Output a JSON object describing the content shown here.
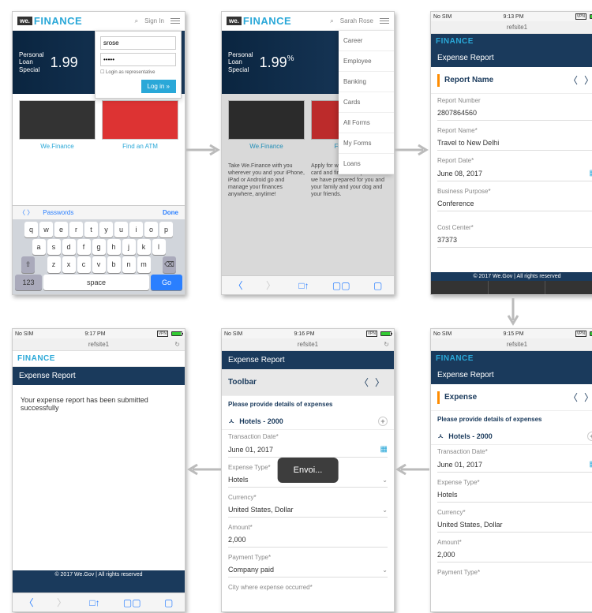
{
  "status": {
    "carrier": "No SIM",
    "vpn": "VPN",
    "t1": "9:13 PM",
    "t2": "9:15 PM",
    "t3": "9:16 PM",
    "t4": "9:17 PM",
    "addr": "refsite1"
  },
  "brand": {
    "we": "we.",
    "fin": "FINANCE",
    "signin": "Sign In",
    "user": "Sarah Rose"
  },
  "login": {
    "u": "srose",
    "p": "•••••",
    "chk": "Login as representative",
    "btn": "Log in »"
  },
  "banner": {
    "l1": "Personal",
    "l2": "Loan",
    "l3": "Special",
    "rate": "1.99",
    "pct": "%"
  },
  "tiles": {
    "a": "We.Finance",
    "b": "Find an ATM",
    "b2": "Find an AT"
  },
  "kb": {
    "pw": "Passwords",
    "done": "Done",
    "n": "123",
    "sp": "space",
    "go": "Go",
    "r1": [
      "q",
      "w",
      "e",
      "r",
      "t",
      "y",
      "u",
      "i",
      "o",
      "p"
    ],
    "r2": [
      "a",
      "s",
      "d",
      "f",
      "g",
      "h",
      "j",
      "k",
      "l"
    ],
    "r3": [
      "z",
      "x",
      "c",
      "v",
      "b",
      "n",
      "m"
    ]
  },
  "menu": [
    "Career",
    "Employee",
    "Banking",
    "Cards",
    "All Forms",
    "My Forms",
    "Loans"
  ],
  "desc": {
    "a": "Take We.Finance with you wherever you and your iPhone, iPad or Android go and manage your finances anywhere, anytime!",
    "b": "Apply for we finance visa credit card and find what special offer we have prepared for you and your family and your dog and your friends."
  },
  "report": {
    "hdr": "Expense Report",
    "sec": "Report Name",
    "f1l": "Report Number",
    "f1v": "2807864560",
    "f2l": "Report Name*",
    "f2v": "Travel to New Delhi",
    "f3l": "Report Date*",
    "f3v": "June 08, 2017",
    "f4l": "Business Purpose*",
    "f4v": "Conference",
    "f5l": "Cost Center*",
    "f5v": "37373"
  },
  "exp": {
    "sec": "Expense",
    "hint": "Please provide details of expenses",
    "acc": "Hotels - 2000",
    "f1l": "Transaction Date*",
    "f1v": "June 01, 2017",
    "f2l": "Expense Type*",
    "f2v": "Hotels",
    "f3l": "Currency*",
    "f3v": "United States, Dollar",
    "f4l": "Amount*",
    "f4v": "2,000",
    "f5l": "Payment Type*",
    "f5v": "Company paid",
    "f6l": "City where expense occurred*"
  },
  "toolbar": "Toolbar",
  "sending": "Envoi...",
  "success": "Your expense report has been submitted successfully",
  "copy": "© 2017 We.Gov | All rights reserved"
}
